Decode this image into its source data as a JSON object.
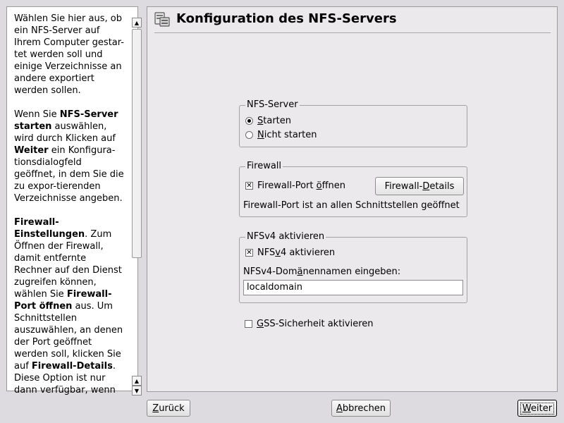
{
  "help": {
    "p1": "Wählen Sie hier aus, ob ein NFS-Server auf Ihrem Computer gestar-tet werden soll und einige Verzeichnisse an andere exportiert werden sollen.",
    "p2_a": "Wenn Sie ",
    "p2_b": "NFS-Server starten",
    "p2_c": " auswählen, wird durch Klicken auf ",
    "p2_d": "Weiter",
    "p2_e": " ein Konfigura-tionsdialogfeld geöffnet, in dem Sie die zu expor-tierenden Verzeichnisse angeben.",
    "p3_a": "Firewall-Einstellungen",
    "p3_b": ". Zum Öffnen der Firewall, damit entfernte Rechner auf den Dienst zugreifen können, wählen Sie ",
    "p3_c": "Firewall-Port öffnen",
    "p3_d": " aus. Um Schnittstellen auszuwählen, an denen der Port geöffnet werden soll, klicken Sie auf ",
    "p3_e": "Firewall-Details",
    "p3_f": ". Diese Option ist nur dann verfügbar, wenn"
  },
  "header": {
    "title": "Konfiguration des NFS-Servers",
    "icon": "server-config-icon"
  },
  "nfs_server": {
    "legend": "NFS-Server",
    "options": [
      {
        "pre": "",
        "u": "S",
        "post": "tarten",
        "selected": true
      },
      {
        "pre": "",
        "u": "N",
        "post": "icht starten",
        "selected": false
      }
    ]
  },
  "firewall": {
    "legend": "Firewall",
    "open_port": {
      "pre": "Firewall-Port ",
      "u": "ö",
      "post": "ffnen",
      "checked": true
    },
    "details_btn": {
      "pre": "Firewall-",
      "u": "D",
      "post": "etails"
    },
    "status": "Firewall-Port ist an allen Schnittstellen geöffnet"
  },
  "nfsv4": {
    "legend": "NFSv4 aktivieren",
    "enable": {
      "pre": "NFS",
      "u": "v",
      "post": "4 aktivieren",
      "checked": true
    },
    "domain_label": {
      "pre": "NFSv4-Dom",
      "u": "ä",
      "post": "nennamen eingeben:"
    },
    "domain_value": "localdomain"
  },
  "gss": {
    "pre": "",
    "u": "G",
    "post": "SS-Sicherheit aktivieren",
    "checked": false
  },
  "footer": {
    "back": {
      "pre": "",
      "u": "Z",
      "post": "urück"
    },
    "abort": {
      "pre": "",
      "u": "A",
      "post": "bbrechen"
    },
    "next": {
      "pre": "",
      "u": "W",
      "post": "eiter"
    }
  },
  "colors": {
    "background": "#dddbe0",
    "panel": "#ece9ec",
    "border": "#a2a2a2"
  }
}
